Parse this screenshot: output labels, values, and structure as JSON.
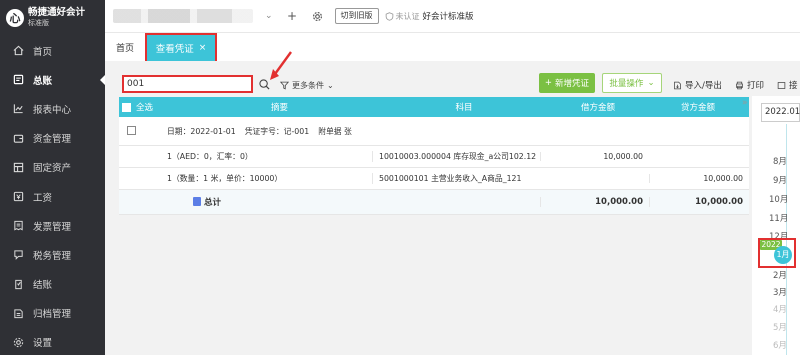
{
  "app": {
    "logo_glyph": "心",
    "title": "畅捷通好会计",
    "edition_badge": "标准版"
  },
  "sidebar": {
    "items": [
      {
        "label": "首页",
        "icon": "home-icon"
      },
      {
        "label": "总账",
        "icon": "ledger-icon",
        "active": true
      },
      {
        "label": "报表中心",
        "icon": "chart-icon"
      },
      {
        "label": "资金管理",
        "icon": "wallet-icon"
      },
      {
        "label": "固定资产",
        "icon": "asset-icon"
      },
      {
        "label": "工资",
        "icon": "salary-icon"
      },
      {
        "label": "发票管理",
        "icon": "invoice-icon"
      },
      {
        "label": "税务管理",
        "icon": "tax-icon"
      },
      {
        "label": "结账",
        "icon": "close-book-icon"
      },
      {
        "label": "归档管理",
        "icon": "archive-icon"
      },
      {
        "label": "设置",
        "icon": "settings-icon"
      }
    ]
  },
  "topbar": {
    "switch_old_label": "切到旧版",
    "unverified_label": "未认证",
    "edition_label": "好会计标准版"
  },
  "tabs": {
    "home": "首页",
    "active": "查看凭证"
  },
  "toolbar": {
    "search_value": "001",
    "filter_label": "更多条件",
    "new_voucher_label": "新增凭证",
    "batch_label": "批量操作",
    "import_export_label": "导入/导出",
    "print_label": "打印",
    "more_label": "接"
  },
  "table": {
    "headers": {
      "select_all": "全选",
      "summary": "摘要",
      "account": "科目",
      "debit": "借方金额",
      "credit": "贷方金额"
    },
    "voucher_header": {
      "date": "日期：2022-01-01",
      "voucher_no": "凭证字号：记-001",
      "attachments": "附单据  张"
    },
    "lines": [
      {
        "summary": "1（AED：0，汇率：0）",
        "account": "10010003.000004  库存现金_a公司102.12",
        "debit": "10,000.00",
        "credit": ""
      },
      {
        "summary": "1（数量：1 米，单价：10000）",
        "account": "5001000101  主营业务收入_A商品_121",
        "debit": "",
        "credit": "10,000.00"
      }
    ],
    "total": {
      "label": "总计",
      "debit": "10,000.00",
      "credit": "10,000.00"
    }
  },
  "timeline": {
    "year_value": "2022.01",
    "months_before": [
      "8月",
      "9月",
      "10月",
      "11月",
      "12月"
    ],
    "year_tag": "2022",
    "active_month": "1月",
    "months_after": [
      "2月",
      "3月",
      "4月",
      "5月",
      "6月"
    ]
  },
  "colors": {
    "sidebar_bg": "#2f3035",
    "accent_teal": "#3dc4d8",
    "accent_green": "#7bc043",
    "highlight_red": "#e23030"
  }
}
